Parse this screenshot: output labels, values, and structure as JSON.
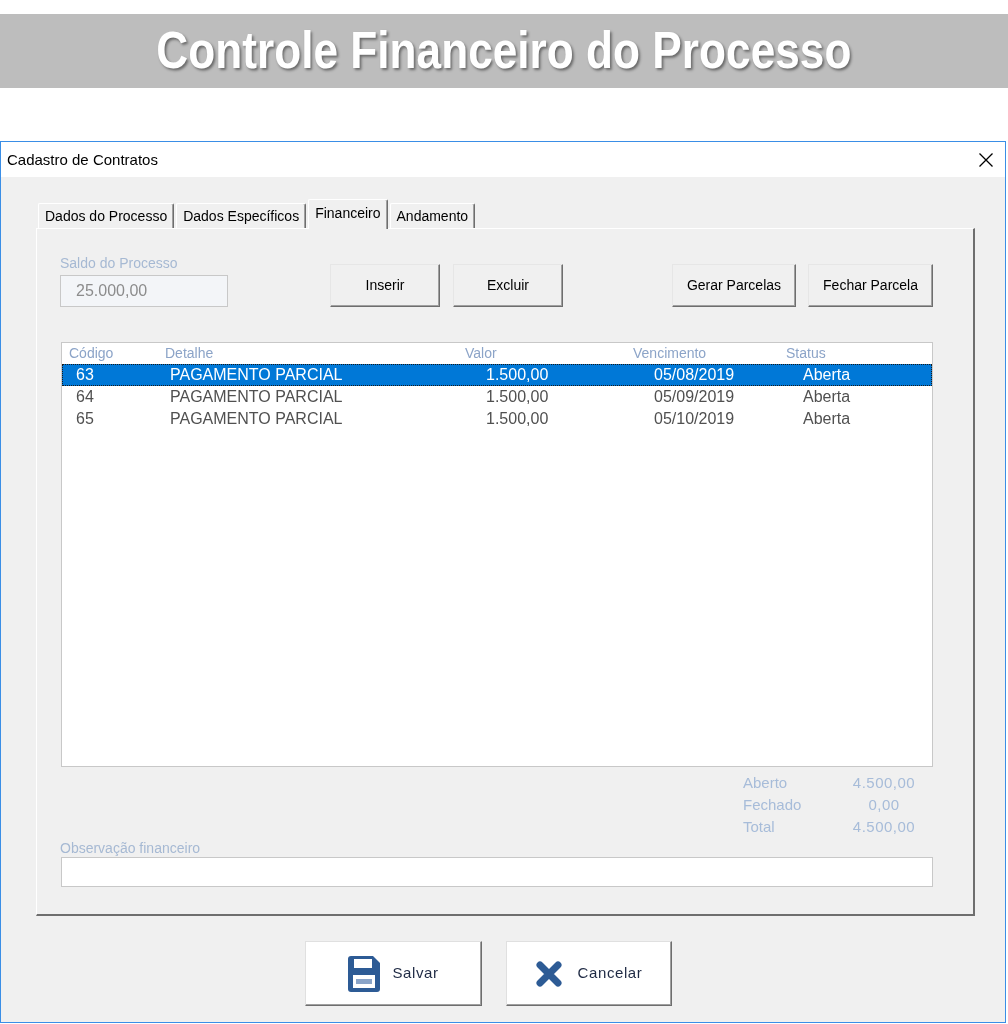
{
  "banner": {
    "title": "Controle Financeiro do Processo"
  },
  "window": {
    "title": "Cadastro de Contratos"
  },
  "tabs": [
    {
      "label": "Dados do Processo",
      "selected": false
    },
    {
      "label": "Dados Específicos",
      "selected": false
    },
    {
      "label": "Financeiro",
      "selected": true
    },
    {
      "label": "Andamento",
      "selected": false
    }
  ],
  "balance": {
    "label": "Saldo do Processo",
    "value": "25.000,00",
    "disabled": true
  },
  "actions": {
    "left": [
      "Inserir",
      "Excluir"
    ],
    "right": [
      "Gerar Parcelas",
      "Fechar Parcela"
    ]
  },
  "list": {
    "columns": [
      "Código",
      "Detalhe",
      "Valor",
      "Vencimento",
      "Status"
    ],
    "rows": [
      {
        "cells": [
          "63",
          "PAGAMENTO PARCIAL",
          "1.500,00",
          "05/08/2019",
          "Aberta"
        ],
        "selected": true
      },
      {
        "cells": [
          "64",
          "PAGAMENTO PARCIAL",
          "1.500,00",
          "05/09/2019",
          "Aberta"
        ],
        "selected": false
      },
      {
        "cells": [
          "65",
          "PAGAMENTO PARCIAL",
          "1.500,00",
          "05/10/2019",
          "Aberta"
        ],
        "selected": false
      }
    ]
  },
  "totals": [
    {
      "label": "Aberto",
      "value": "4.500,00"
    },
    {
      "label": "Fechado",
      "value": "0,00"
    },
    {
      "label": "Total",
      "value": "4.500,00"
    }
  ],
  "notes": {
    "label": "Observação financeiro"
  },
  "buttons": [
    {
      "label": "Salvar",
      "kind": "save"
    },
    {
      "label": "Cancelar",
      "kind": "cancel"
    }
  ]
}
